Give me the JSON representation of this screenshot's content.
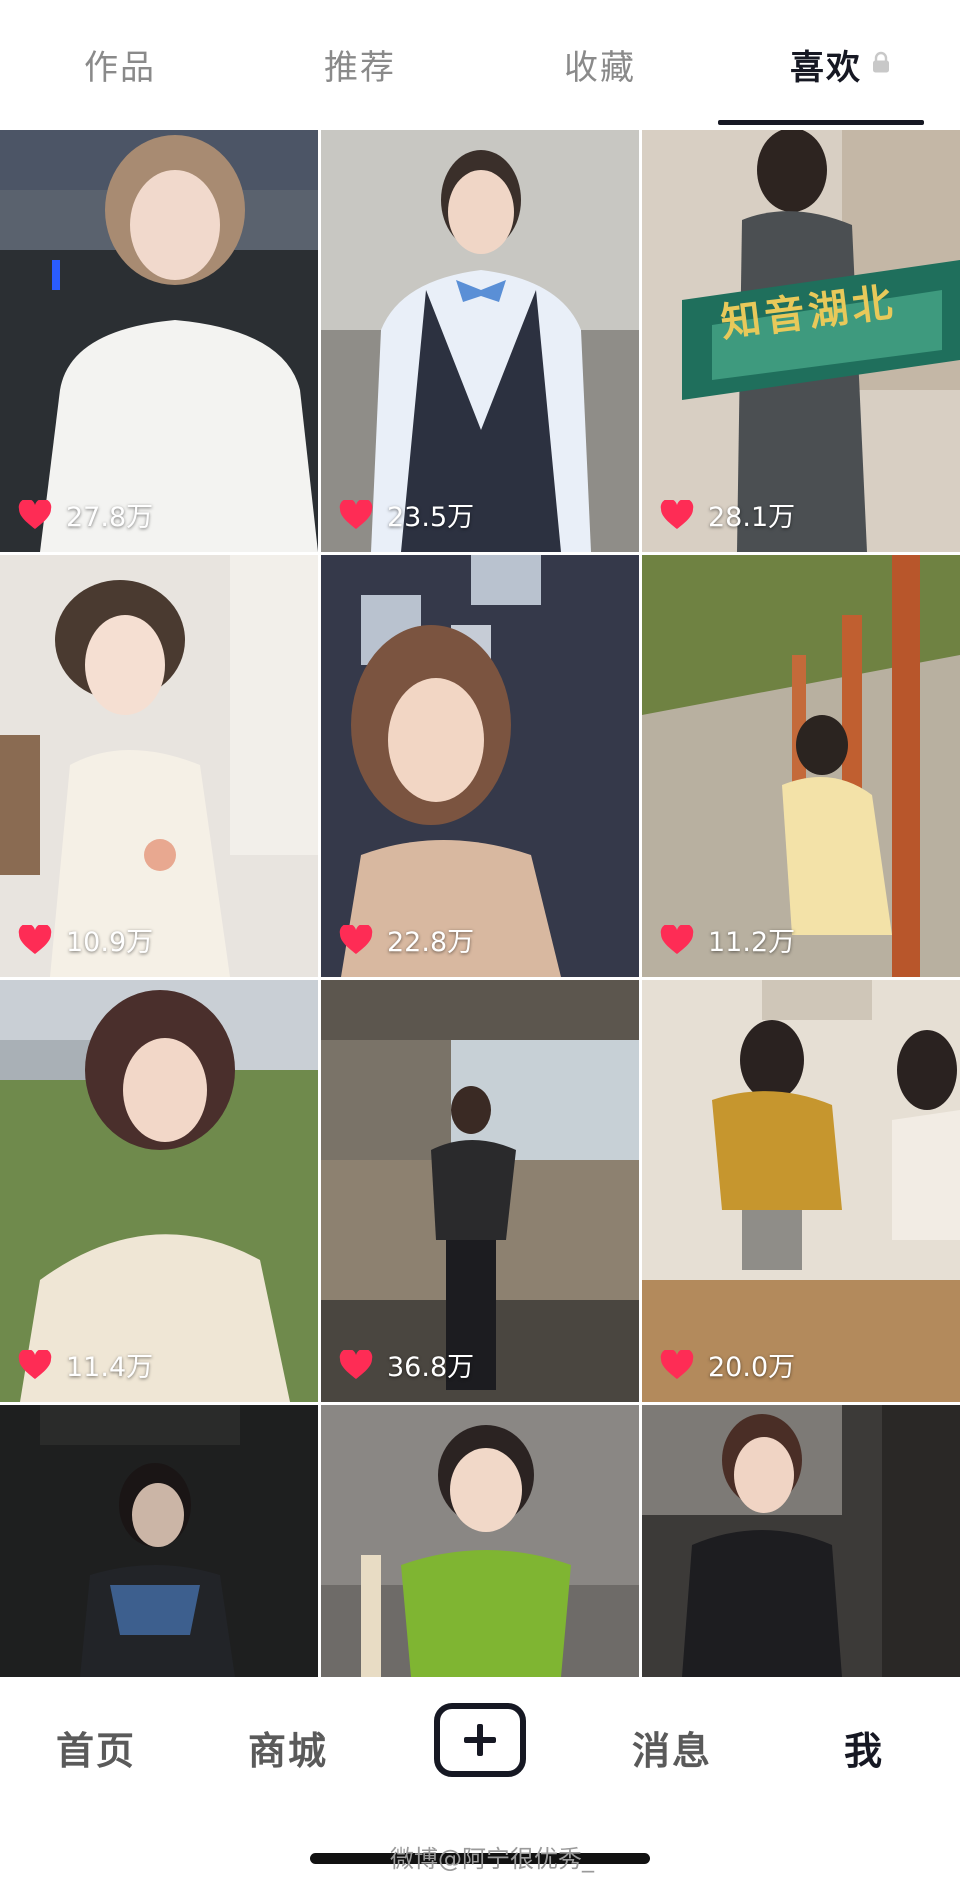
{
  "tabs": [
    {
      "label": "作品",
      "active": false
    },
    {
      "label": "推荐",
      "active": false
    },
    {
      "label": "收藏",
      "active": false
    },
    {
      "label": "喜欢",
      "active": true,
      "icon": "lock-icon"
    }
  ],
  "videos": [
    {
      "likes": "27.8万"
    },
    {
      "likes": "23.5万"
    },
    {
      "likes": "28.1万"
    },
    {
      "likes": "10.9万"
    },
    {
      "likes": "22.8万"
    },
    {
      "likes": "11.2万"
    },
    {
      "likes": "11.4万"
    },
    {
      "likes": "36.8万"
    },
    {
      "likes": "20.0万"
    },
    {
      "likes": ""
    },
    {
      "likes": ""
    },
    {
      "likes": ""
    }
  ],
  "banner_text": "知音湖北",
  "bottom_nav": {
    "home": "首页",
    "mall": "商城",
    "add": "+",
    "messages": "消息",
    "me": "我"
  },
  "watermark": "微博@阿宁很优秀_",
  "colors": {
    "heart": "#fe2c55",
    "text_active": "#161823",
    "text_inactive": "#8a8a8a"
  }
}
